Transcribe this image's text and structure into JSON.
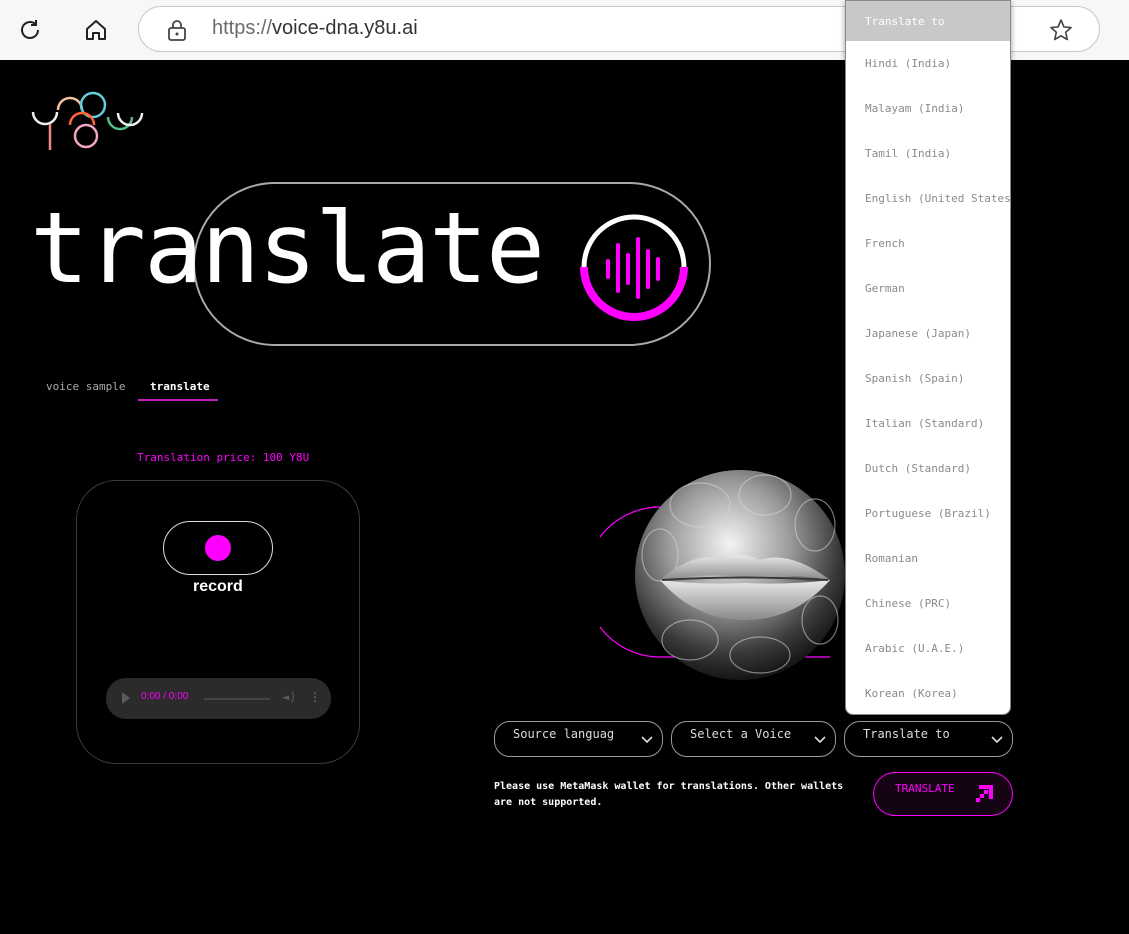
{
  "browser": {
    "url_scheme": "https://",
    "url_host": "voice-dna.y8u.ai"
  },
  "hero": {
    "title": "translate"
  },
  "tabs": [
    {
      "label": "voice sample",
      "active": false
    },
    {
      "label": "translate",
      "active": true
    }
  ],
  "price_text": "Translation price: 100 Y8U",
  "recorder": {
    "record_label": "record",
    "audio_time": "0:00 / 0:00"
  },
  "selects": {
    "source": "Source languag",
    "voice": "Select a Voice",
    "target": "Translate to"
  },
  "notice": "Please use MetaMask wallet for translations. Other wallets are not supported.",
  "translate_button": "TRANSLATE",
  "dropdown": {
    "selected": "Translate to",
    "options": [
      "Hindi (India)",
      "Malayam (India)",
      "Tamil (India)",
      "English (United States)",
      "French",
      "German",
      "Japanese (Japan)",
      "Spanish (Spain)",
      "Italian (Standard)",
      "Dutch (Standard)",
      "Portuguese (Brazil)",
      "Romanian",
      "Chinese (PRC)",
      "Arabic (U.A.E.)",
      "Korean (Korea)"
    ]
  },
  "colors": {
    "accent": "#ff00ff",
    "background": "#000000"
  }
}
